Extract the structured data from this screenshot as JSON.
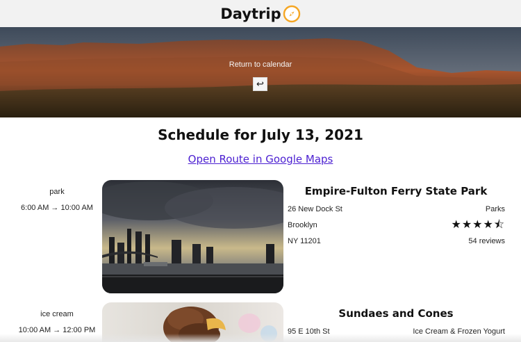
{
  "header": {
    "brand": "Daytrip",
    "logo_icon": "compass-icon",
    "accent": "#f5a623"
  },
  "hero": {
    "return_label": "Return to calendar",
    "return_icon": "return-arrow-icon",
    "return_glyph": "↩"
  },
  "page": {
    "title": "Schedule for July 13, 2021",
    "maps_link": "Open Route in Google Maps"
  },
  "entries": [
    {
      "category": "park",
      "time": "6:00 AM → 10:00 AM",
      "name": "Empire-Fulton Ferry State Park",
      "street": "26 New Dock St",
      "city": "Brooklyn",
      "state_zip": "NY 11201",
      "type": "Parks",
      "rating": 4.5,
      "stars_glyph": "★★★★⯪",
      "reviews": "54 reviews"
    },
    {
      "category": "ice cream",
      "time": "10:00 AM → 12:00 PM",
      "name": "Sundaes and Cones",
      "street": "95 E 10th St",
      "type": "Ice Cream & Frozen Yogurt"
    }
  ]
}
